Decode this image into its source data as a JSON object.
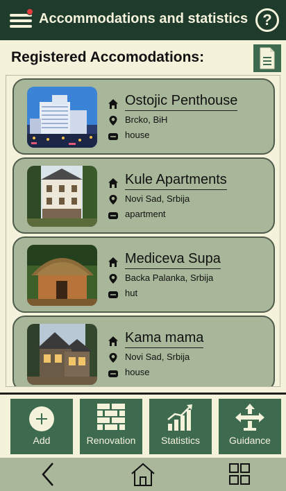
{
  "header": {
    "title": "Accommodations and statistics",
    "help_label": "?"
  },
  "list": {
    "heading": "Registered Accomodations:",
    "items": [
      {
        "name": "Ostojic Penthouse",
        "location": "Brcko, BiH",
        "type": "house",
        "image": "hotel-tower-photo"
      },
      {
        "name": "Kule Apartments",
        "location": "Novi Sad, Srbija",
        "type": "apartment",
        "image": "apartment-building-photo"
      },
      {
        "name": "Mediceva Supa",
        "location": "Backa Palanka, Srbija",
        "type": "hut",
        "image": "thatched-hut-photo"
      },
      {
        "name": "Kama mama",
        "location": "Novi Sad, Srbija",
        "type": "house",
        "image": "wooden-house-photo"
      }
    ]
  },
  "actions": [
    {
      "label": "Add",
      "icon": "plus-circle-icon"
    },
    {
      "label": "Renovation",
      "icon": "brick-wall-icon"
    },
    {
      "label": "Statistics",
      "icon": "bar-chart-icon"
    },
    {
      "label": "Guidance",
      "icon": "signpost-arrows-icon"
    }
  ],
  "nav": {
    "back": "back-chevron-icon",
    "home": "home-icon",
    "apps": "grid-icon"
  },
  "colors": {
    "header_bg": "#1f3b2c",
    "page_bg": "#f5f2dc",
    "card_bg": "#a8b79a",
    "button_bg": "#3e6b50",
    "navbar_bg": "#aab79a",
    "notification": "#e23c3c"
  }
}
